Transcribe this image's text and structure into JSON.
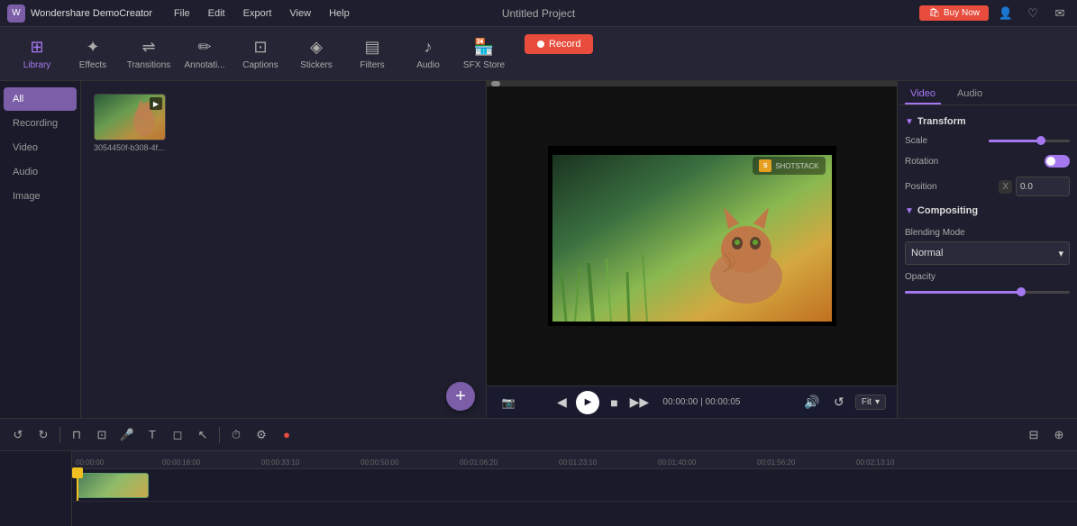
{
  "app": {
    "title": "Untitled Project",
    "logo_text": "Wondershare DemoCreator"
  },
  "menu": {
    "items": [
      "File",
      "Edit",
      "Export",
      "View",
      "Help"
    ],
    "buy_now": "Buy Now"
  },
  "toolbar": {
    "items": [
      {
        "id": "library",
        "label": "Library",
        "icon": "📚",
        "active": true
      },
      {
        "id": "effects",
        "label": "Effects",
        "icon": "✨",
        "active": false
      },
      {
        "id": "transitions",
        "label": "Transitions",
        "icon": "🔀",
        "active": false
      },
      {
        "id": "annotations",
        "label": "Annotati...",
        "icon": "✏️",
        "active": false
      },
      {
        "id": "captions",
        "label": "Captions",
        "icon": "💬",
        "active": false
      },
      {
        "id": "stickers",
        "label": "Stickers",
        "icon": "🌟",
        "active": false
      },
      {
        "id": "filters",
        "label": "Filters",
        "icon": "🎨",
        "active": false
      },
      {
        "id": "audio",
        "label": "Audio",
        "icon": "🎵",
        "active": false
      },
      {
        "id": "sfxstore",
        "label": "SFX Store",
        "icon": "🛒",
        "active": false
      }
    ],
    "record_label": "Record"
  },
  "library": {
    "sidebar": [
      {
        "id": "all",
        "label": "All",
        "active": true
      },
      {
        "id": "recording",
        "label": "Recording",
        "active": false
      },
      {
        "id": "video",
        "label": "Video",
        "active": false
      },
      {
        "id": "audio",
        "label": "Audio",
        "active": false
      },
      {
        "id": "image",
        "label": "Image",
        "active": false
      }
    ],
    "media": [
      {
        "id": "media1",
        "label": "3054450f-b308-4f...",
        "type": "video"
      }
    ]
  },
  "preview": {
    "shotstack_label": "SHOTSTACK",
    "time_current": "00:00:00",
    "time_total": "00:00:05",
    "fit_label": "Fit"
  },
  "right_panel": {
    "tabs": [
      {
        "id": "video",
        "label": "Video",
        "active": true
      },
      {
        "id": "audio",
        "label": "Audio",
        "active": false
      }
    ],
    "transform_title": "Transform",
    "scale_label": "Scale",
    "rotation_label": "Rotation",
    "position_label": "Position",
    "position_x_label": "X",
    "position_x_value": "0.0",
    "compositing_title": "Compositing",
    "blending_mode_label": "Blending Mode",
    "blending_mode_value": "Normal",
    "opacity_label": "Opacity"
  },
  "timeline": {
    "toolbar_buttons": [
      "undo",
      "redo",
      "split",
      "crop",
      "mic",
      "text",
      "shape",
      "cursor",
      "timer",
      "delete"
    ],
    "ruler_marks": [
      "00:00:00",
      "00:00:16:00",
      "00:00:33:10",
      "00:00:50:00",
      "00:01:06:20",
      "00:01:23:10",
      "00:01:40:00",
      "00:01:56:20",
      "00:02:13:10"
    ]
  }
}
